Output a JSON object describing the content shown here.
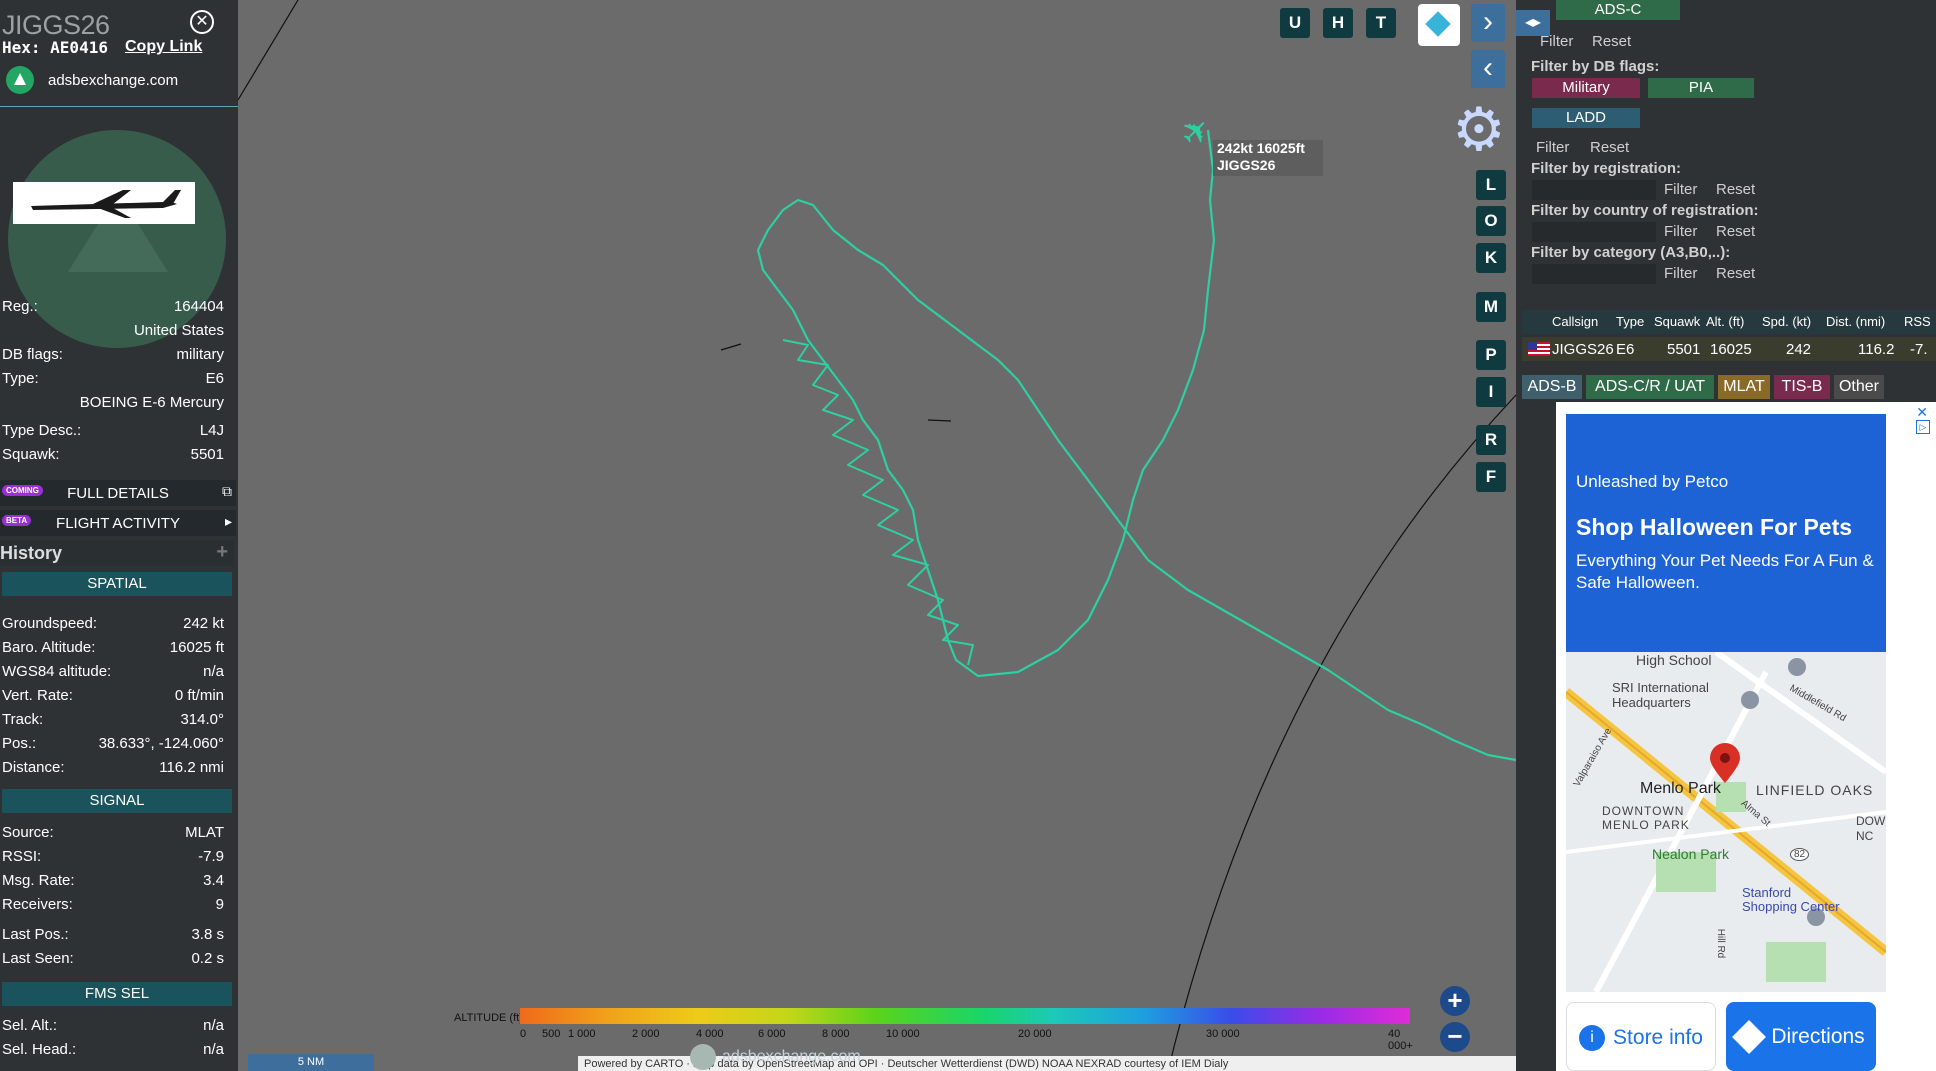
{
  "aircraft": {
    "callsign": "JIGGS26",
    "hex_label": "Hex: AE0416",
    "copy_link": "Copy Link",
    "site": "adsbexchange.com",
    "close_icon": "close-icon"
  },
  "details": [
    {
      "key": "Reg.:",
      "value": "164404"
    },
    {
      "key": "",
      "value": "United States"
    },
    {
      "key": "DB flags:",
      "value": "military"
    },
    {
      "key": "Type:",
      "value": "E6"
    },
    {
      "key": "",
      "value": "BOEING E-6 Mercury"
    },
    {
      "key": "Type Desc.:",
      "value": "L4J"
    },
    {
      "key": "Squawk:",
      "value": "5501"
    }
  ],
  "actions": {
    "full_details_badge": "COMING",
    "full_details": "FULL DETAILS",
    "flight_activity_badge": "BETA",
    "flight_activity": "FLIGHT ACTIVITY",
    "history": "History"
  },
  "spatial": {
    "title": "SPATIAL",
    "rows": [
      {
        "key": "Groundspeed:",
        "value": "242 kt"
      },
      {
        "key": "Baro. Altitude:",
        "value": "16025 ft"
      },
      {
        "key": "WGS84 altitude:",
        "value": "n/a"
      },
      {
        "key": "Vert. Rate:",
        "value": "0 ft/min"
      },
      {
        "key": "Track:",
        "value": "314.0°"
      },
      {
        "key": "Pos.:",
        "value": "38.633°, -124.060°"
      },
      {
        "key": "Distance:",
        "value": "116.2 nmi"
      }
    ]
  },
  "signal": {
    "title": "SIGNAL",
    "rows": [
      {
        "key": "Source:",
        "value": "MLAT"
      },
      {
        "key": "RSSI:",
        "value": "-7.9"
      },
      {
        "key": "Msg. Rate:",
        "value": "3.4"
      },
      {
        "key": "Receivers:",
        "value": "9"
      },
      {
        "key": "Last Pos.:",
        "value": "3.8 s"
      },
      {
        "key": "Last Seen:",
        "value": "0.2 s"
      }
    ]
  },
  "fms": {
    "title": "FMS SEL",
    "rows": [
      {
        "key": "Sel. Alt.:",
        "value": "n/a"
      },
      {
        "key": "Sel. Head.:",
        "value": "n/a"
      }
    ]
  },
  "map": {
    "top_buttons": [
      "U",
      "H",
      "T"
    ],
    "side_buttons": [
      "L",
      "O",
      "K",
      "M",
      "P",
      "I",
      "R",
      "F"
    ],
    "aircraft_label_line1": "242kt 16025ft",
    "aircraft_label_line2": "JIGGS26",
    "track_color": "#2ecfa0",
    "altitude_legend_title": "ALTITUDE (ft)",
    "altitude_ticks": [
      "0",
      "500",
      "1 000",
      "2 000",
      "4 000",
      "6 000",
      "8 000",
      "10 000",
      "20 000",
      "30 000",
      "40 000+"
    ],
    "scale": "5 NM",
    "attribution": "Powered by CARTO · map data by OpenStreetMap and OPI · Deutscher Wetterdienst (DWD) NOAA NEXRAD courtesy of IEM Dialy",
    "watermark": "adsbexchange.com",
    "zoom_in": "+",
    "zoom_out": "−"
  },
  "filters": {
    "adsc": "ADS-C",
    "filter": "Filter",
    "reset": "Reset",
    "db_flags_label": "Filter by DB flags:",
    "military": "Military",
    "pia": "PIA",
    "ladd": "LADD",
    "registration_label": "Filter by registration:",
    "country_label": "Filter by country of registration:",
    "category_label": "Filter by category (A3,B0,..):",
    "toggle": "◂▸"
  },
  "table": {
    "headers": [
      "Callsign",
      "Type",
      "Squawk",
      "Alt. (ft)",
      "Spd. (kt)",
      "Dist. (nmi)",
      "RSS"
    ],
    "row": {
      "callsign": "JIGGS26",
      "type": "E6",
      "squawk": "5501",
      "alt": "16025",
      "spd": "242",
      "dist": "116.2",
      "rssi": "-7."
    }
  },
  "source_tabs": [
    {
      "label": "ADS-B",
      "color": "#3f5f6d"
    },
    {
      "label": "ADS-C/R / UAT",
      "color": "#2f6b48"
    },
    {
      "label": "MLAT",
      "color": "#8a6a27"
    },
    {
      "label": "TIS-B",
      "color": "#7a2a4d"
    },
    {
      "label": "Other",
      "color": "#4a4a4a"
    }
  ],
  "ad": {
    "brand": "Unleashed by Petco",
    "headline": "Shop Halloween For Pets",
    "body": "Everything Your Pet Needs For A Fun & Safe Halloween.",
    "store_info": "Store info",
    "directions": "Directions",
    "map_labels": {
      "high_school": "High School",
      "sri": "SRI International Headquarters",
      "middlefield": "Middlefield Rd",
      "valparaiso": "Valparaiso Ave",
      "menlo_park": "Menlo Park",
      "linfield": "LINFIELD OAKS",
      "downtown": "DOWNTOWN MENLO PARK",
      "alma": "Alma St",
      "nealon": "Nealon Park",
      "stanford": "Stanford Shopping Center",
      "dow": "DOW NC",
      "hill_rd": "Hill Rd",
      "route": "82"
    }
  }
}
